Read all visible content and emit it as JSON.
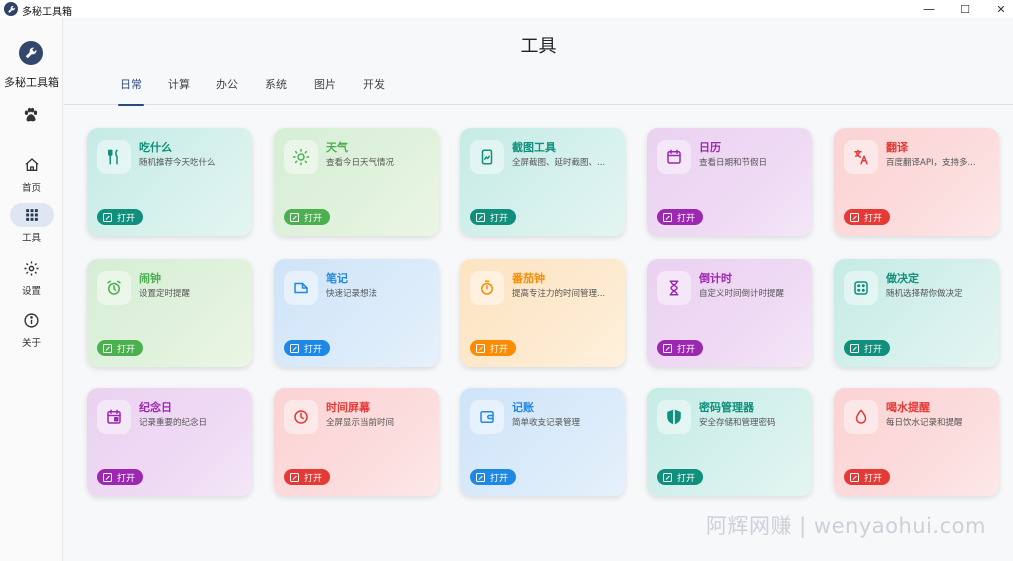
{
  "window": {
    "title": "多秘工具箱",
    "minimize": "—",
    "maximize": "☐",
    "close": "✕"
  },
  "sidebar": {
    "brand": "多秘工具箱",
    "items": [
      {
        "label": "首页",
        "icon": "home-icon"
      },
      {
        "label": "工具",
        "icon": "grid-icon",
        "active": true
      },
      {
        "label": "设置",
        "icon": "gear-icon"
      },
      {
        "label": "关于",
        "icon": "info-icon"
      }
    ]
  },
  "page": {
    "title": "工具"
  },
  "tabs": [
    "日常",
    "计算",
    "办公",
    "系统",
    "图片",
    "开发"
  ],
  "open_label": "打开",
  "cards": [
    {
      "title": "吃什么",
      "desc": "随机推荐今天吃什么",
      "icon": "utensils-icon",
      "accent": "#0f8f7c"
    },
    {
      "title": "天气",
      "desc": "查看今日天气情况",
      "icon": "sun-icon",
      "accent": "#4caf50"
    },
    {
      "title": "截图工具",
      "desc": "全屏截图、延时截图、...",
      "icon": "screenshot-icon",
      "accent": "#0f8f7c"
    },
    {
      "title": "日历",
      "desc": "查看日期和节假日",
      "icon": "calendar-icon",
      "accent": "#9c27b0"
    },
    {
      "title": "翻译",
      "desc": "百度翻译API，支持多...",
      "icon": "translate-icon",
      "accent": "#e53935"
    },
    {
      "title": "闹钟",
      "desc": "设置定时提醒",
      "icon": "alarm-icon",
      "accent": "#4caf50"
    },
    {
      "title": "笔记",
      "desc": "快速记录想法",
      "icon": "note-icon",
      "accent": "#1e88e5"
    },
    {
      "title": "番茄钟",
      "desc": "提高专注力的时间管理...",
      "icon": "timer-icon",
      "accent": "#fb8c00"
    },
    {
      "title": "倒计时",
      "desc": "自定义时间倒计时提醒",
      "icon": "hourglass-icon",
      "accent": "#9c27b0"
    },
    {
      "title": "做决定",
      "desc": "随机选择帮你做决定",
      "icon": "dice-icon",
      "accent": "#0f8f7c"
    },
    {
      "title": "纪念日",
      "desc": "记录重要的纪念日",
      "icon": "event-icon",
      "accent": "#9c27b0"
    },
    {
      "title": "时间屏幕",
      "desc": "全屏显示当前时间",
      "icon": "clock-icon",
      "accent": "#e53935"
    },
    {
      "title": "记账",
      "desc": "简单收支记录管理",
      "icon": "wallet-icon",
      "accent": "#1e88e5"
    },
    {
      "title": "密码管理器",
      "desc": "安全存储和管理密码",
      "icon": "shield-icon",
      "accent": "#0f8f7c"
    },
    {
      "title": "喝水提醒",
      "desc": "每日饮水记录和提醒",
      "icon": "water-drop-icon",
      "accent": "#e53935"
    }
  ],
  "watermark": "阿辉网赚 | wenyaohui.com"
}
